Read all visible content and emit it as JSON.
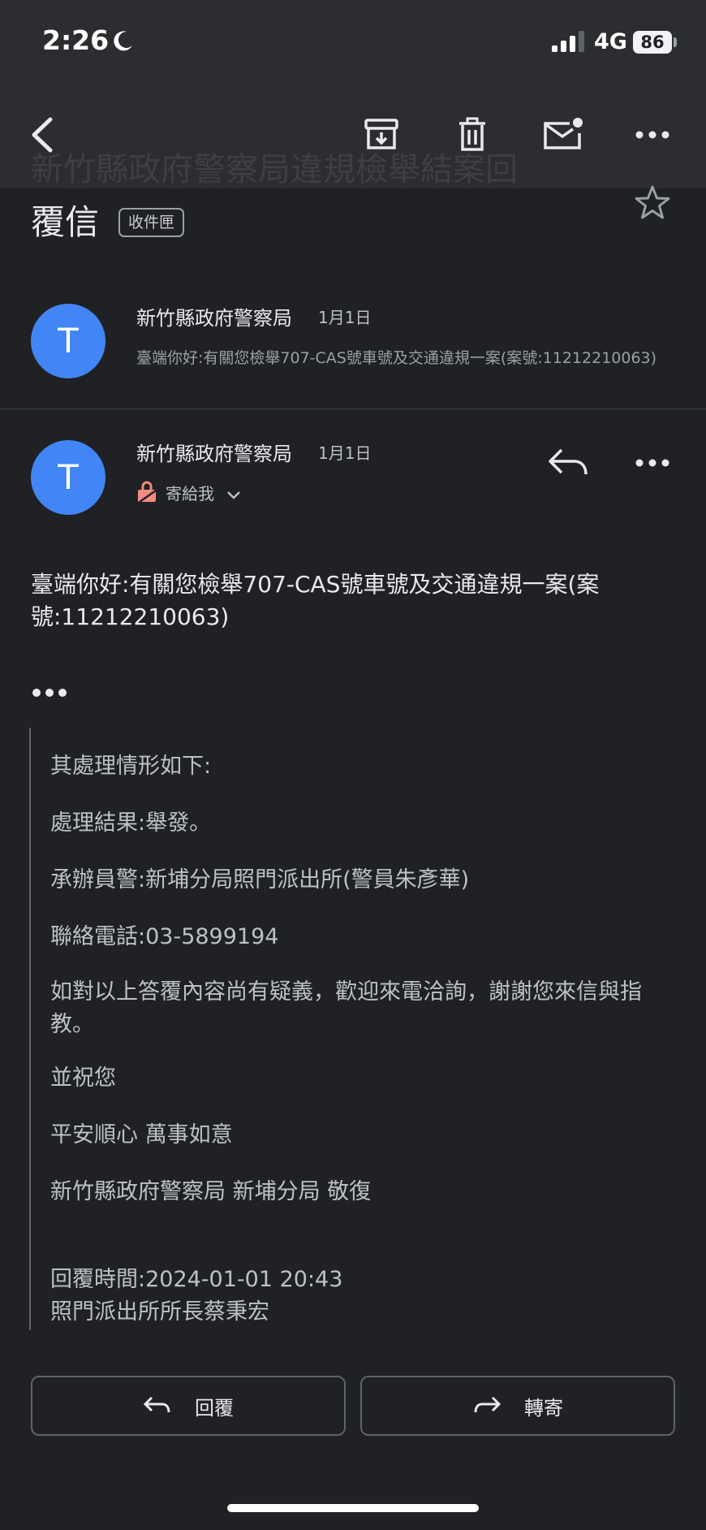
{
  "status_bar": {
    "time": "2:26",
    "network": "4G",
    "battery": "86"
  },
  "colors": {
    "background": "#202124",
    "toolbar": "#2c2d30",
    "avatar": "#4285f4",
    "text": "#e8eaed",
    "muted": "#9aa0a6"
  },
  "toolbar": {
    "icons": [
      "back-icon",
      "archive-icon",
      "trash-icon",
      "mark-unread-icon",
      "more-icon"
    ]
  },
  "email": {
    "subject_hidden_line": "新竹縣政府警察局違規檢舉結案回",
    "subject_visible_line": "覆信",
    "label": "收件匣"
  },
  "thread": [
    {
      "avatar_letter": "T",
      "sender": "新竹縣政府警察局",
      "date": "1月1日",
      "snippet": "臺端你好:有關您檢舉707-CAS號車號及交通違規一案(案號:11212210063)"
    },
    {
      "avatar_letter": "T",
      "sender": "新竹縣政府警察局",
      "date": "1月1日",
      "recipient": "寄給我"
    }
  ],
  "message": {
    "intro": "臺端你好:有關您檢舉707-CAS號車號及交通違規一案(案號:11212210063)",
    "quoted": [
      "其處理情形如下:",
      "處理結果:舉發。",
      "承辦員警:新埔分局照門派出所(警員朱彥華)",
      "聯絡電話:03-5899194",
      "如對以上答覆內容尚有疑義，歡迎來電洽詢，謝謝您來信與指教。",
      "並祝您",
      "平安順心 萬事如意",
      "新竹縣政府警察局 新埔分局 敬復",
      "回覆時間:2024-01-01 20:43",
      "照門派出所所長蔡秉宏"
    ]
  },
  "actions": {
    "reply": "回覆",
    "forward": "轉寄"
  }
}
